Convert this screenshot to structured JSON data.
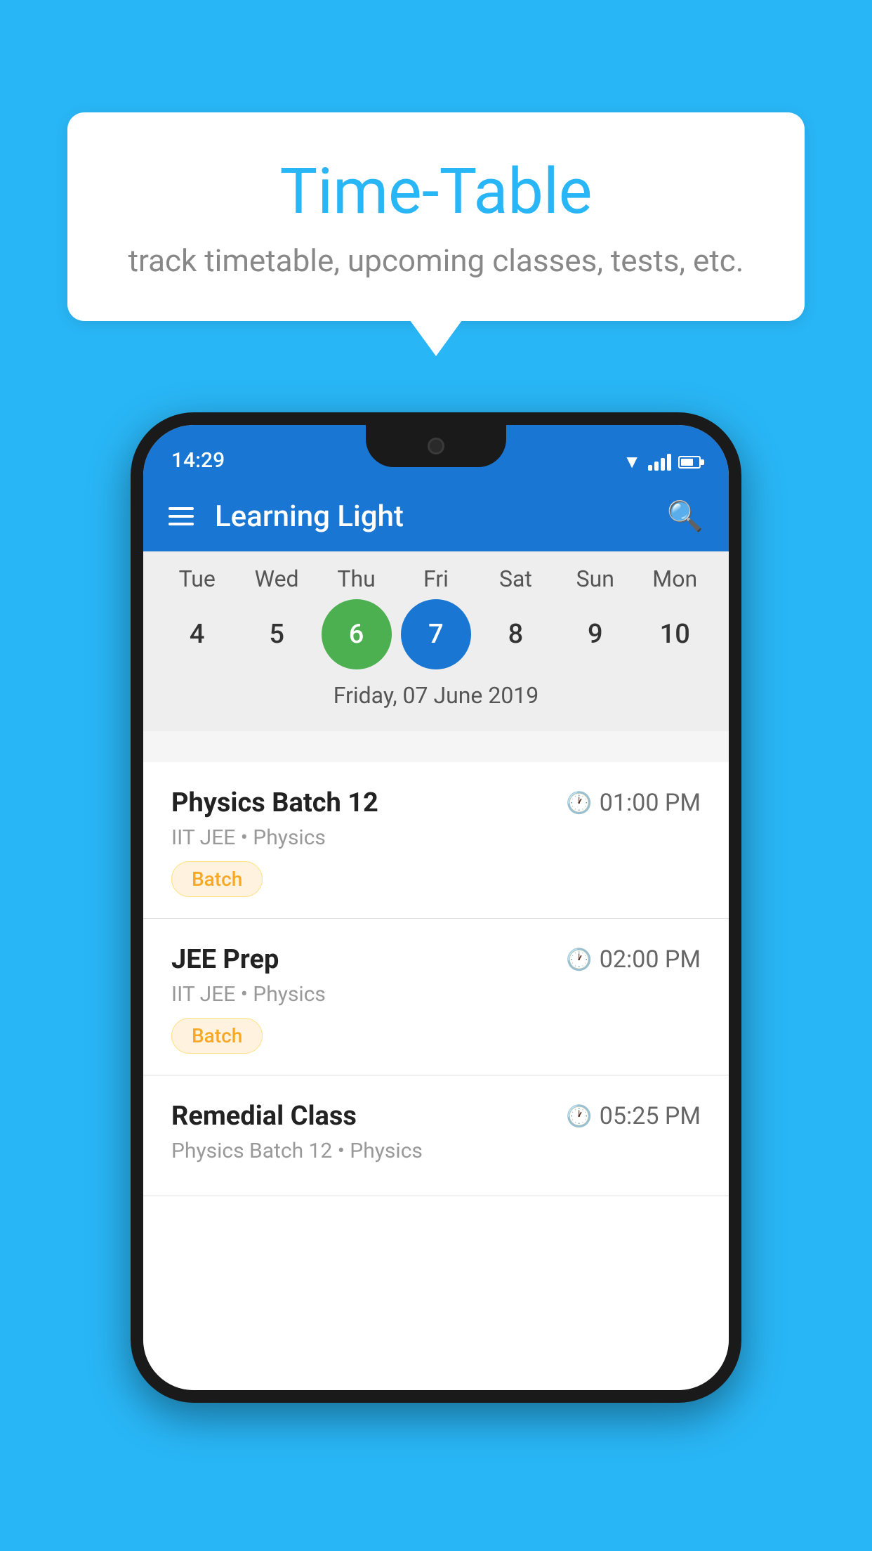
{
  "background_color": "#29B6F6",
  "bubble": {
    "title": "Time-Table",
    "subtitle": "track timetable, upcoming classes, tests, etc."
  },
  "phone": {
    "status_bar": {
      "time": "14:29"
    },
    "app_bar": {
      "title": "Learning Light"
    },
    "calendar": {
      "days": [
        "Tue",
        "Wed",
        "Thu",
        "Fri",
        "Sat",
        "Sun",
        "Mon"
      ],
      "dates": [
        {
          "date": "4",
          "state": "normal"
        },
        {
          "date": "5",
          "state": "normal"
        },
        {
          "date": "6",
          "state": "today"
        },
        {
          "date": "7",
          "state": "selected"
        },
        {
          "date": "8",
          "state": "normal"
        },
        {
          "date": "9",
          "state": "normal"
        },
        {
          "date": "10",
          "state": "normal"
        }
      ],
      "selected_date_label": "Friday, 07 June 2019"
    },
    "schedule": [
      {
        "name": "Physics Batch 12",
        "time": "01:00 PM",
        "category": "IIT JEE • Physics",
        "tag": "Batch"
      },
      {
        "name": "JEE Prep",
        "time": "02:00 PM",
        "category": "IIT JEE • Physics",
        "tag": "Batch"
      },
      {
        "name": "Remedial Class",
        "time": "05:25 PM",
        "category": "Physics Batch 12 • Physics",
        "tag": ""
      }
    ]
  }
}
